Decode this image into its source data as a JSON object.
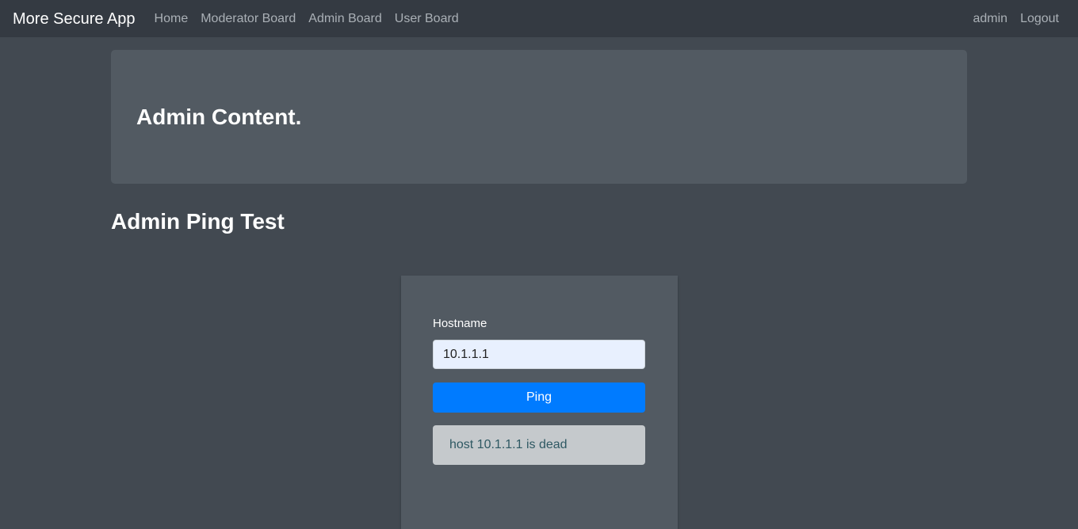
{
  "navbar": {
    "brand": "More Secure App",
    "left_links": [
      "Home",
      "Moderator Board",
      "Admin Board",
      "User Board"
    ],
    "right_links": [
      "admin",
      "Logout"
    ]
  },
  "jumbotron": {
    "heading": "Admin Content."
  },
  "section": {
    "title": "Admin Ping Test"
  },
  "ping_form": {
    "hostname_label": "Hostname",
    "hostname_value": "10.1.1.1",
    "button_label": "Ping",
    "result_text": "host 10.1.1.1 is dead"
  }
}
